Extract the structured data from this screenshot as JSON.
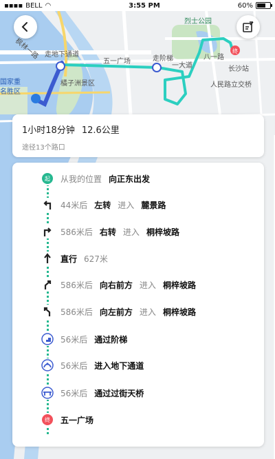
{
  "status_bar": {
    "carrier": "BELL",
    "time": "3:55 PM",
    "battery": "60%"
  },
  "map": {
    "labels": {
      "road_feilin": "枫林一路",
      "underpass": "走地下通道",
      "wuyi_square": "五一广场",
      "stairs": "走阶梯",
      "yida_road": "一大道",
      "bayi_road": "八一路",
      "martyrs_park": "烈士公园",
      "changsha_station": "长沙站",
      "renmin_road": "人民路立交桥",
      "juzizhou": "橘子洲景区",
      "national": "国家重",
      "famous": "名胜区"
    }
  },
  "header": {
    "back_icon": "back-arrow-icon",
    "feedback_icon": "edit-note-icon"
  },
  "summary": {
    "duration": "1小时18分钟",
    "distance": "12.6公里",
    "intersections": "途径13个路口"
  },
  "steps": [
    {
      "icon": "start-badge-icon",
      "badge": "起",
      "prefix": "从我的位置",
      "action": "向正东出发",
      "enter": "",
      "road": ""
    },
    {
      "icon": "turn-left-icon",
      "prefix": "44米后",
      "action": "左转",
      "enter": "进入",
      "road": "麓景路"
    },
    {
      "icon": "turn-right-icon",
      "prefix": "586米后",
      "action": "右转",
      "enter": "进入",
      "road": "桐梓坡路"
    },
    {
      "icon": "straight-icon",
      "prefix": "",
      "action": "直行",
      "enter": "",
      "road": "627米"
    },
    {
      "icon": "bear-right-icon",
      "prefix": "586米后",
      "action": "向右前方",
      "enter": "进入",
      "road": "桐梓坡路"
    },
    {
      "icon": "bear-left-icon",
      "prefix": "586米后",
      "action": "向左前方",
      "enter": "进入",
      "road": "桐梓坡路"
    },
    {
      "icon": "stairs-icon",
      "prefix": "56米后",
      "action": "通过阶梯",
      "enter": "",
      "road": ""
    },
    {
      "icon": "underpass-icon",
      "prefix": "56米后",
      "action": "进入地下通道",
      "enter": "",
      "road": ""
    },
    {
      "icon": "footbridge-icon",
      "prefix": "56米后",
      "action": "通过过街天桥",
      "enter": "",
      "road": ""
    },
    {
      "icon": "end-badge-icon",
      "badge": "终",
      "prefix": "",
      "action": "五一广场",
      "enter": "",
      "road": ""
    }
  ]
}
